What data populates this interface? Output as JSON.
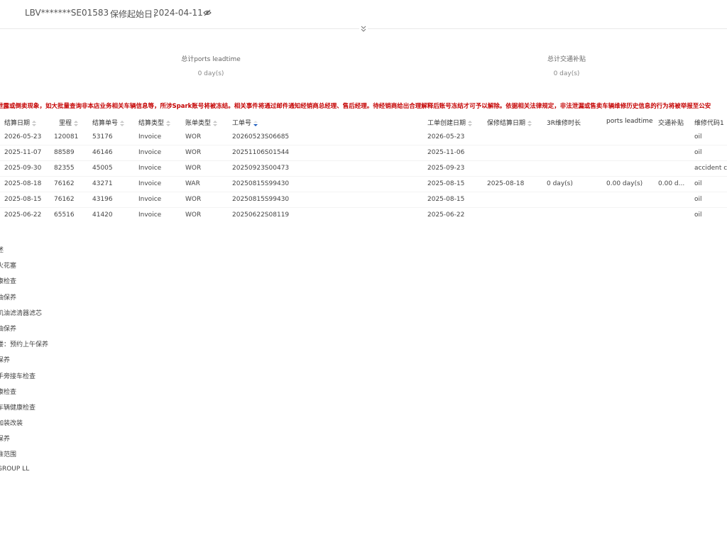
{
  "header": {
    "vin": "LBV*******SE01583",
    "warranty_start_label": "保修起始日：",
    "warranty_start_date": "2024-04-11",
    "visibility_icon": "eye-slash-icon",
    "expand_icon": "chevron-double-down-icon"
  },
  "stats": [
    {
      "label": "总计ports leadtime",
      "value": "0 day(s)"
    },
    {
      "label": "总计交通补贴",
      "value": "0 day(s)"
    }
  ],
  "warning": "泄露或倒卖现象，如大批量查询非本店业务相关车辆信息等，所涉Spark账号将被冻结。相关事件将通过邮件通知经销商总经理、售后经理。待经销商给出合理解释后账号冻结才可予以解除。依据相关法律规定，非法泄漏或售卖车辆维修历史信息的行为将被举报至公安",
  "table": {
    "columns": [
      {
        "label": "结算日期",
        "sortable": true
      },
      {
        "label": "里程",
        "sortable": true
      },
      {
        "label": "结算单号",
        "sortable": true
      },
      {
        "label": "结算类型",
        "sortable": true
      },
      {
        "label": "账单类型",
        "sortable": true
      },
      {
        "label": "工单号",
        "sortable": true,
        "active": true
      },
      {
        "label": "工单创建日期",
        "sortable": true
      },
      {
        "label": "保修结算日期",
        "sortable": true
      },
      {
        "label": "3R维修时长",
        "sortable": false
      },
      {
        "label": "ports leadtime",
        "sortable": false
      },
      {
        "label": "交通补贴",
        "sortable": false
      },
      {
        "label": "维修代码1",
        "sortable": false
      }
    ],
    "rows": [
      [
        "2026-05-23",
        "120081",
        "53176",
        "Invoice",
        "WOR",
        "20260523S06685",
        "2026-05-23",
        "",
        "",
        "",
        "",
        "oil"
      ],
      [
        "2025-11-07",
        "88589",
        "46146",
        "Invoice",
        "WOR",
        "20251106S01544",
        "2025-11-06",
        "",
        "",
        "",
        "",
        "oil"
      ],
      [
        "2025-09-30",
        "82355",
        "45005",
        "Invoice",
        "WOR",
        "20250923S00473",
        "2025-09-23",
        "",
        "",
        "",
        "",
        "accident cor"
      ],
      [
        "2025-08-18",
        "76162",
        "43271",
        "Invoice",
        "WAR",
        "20250815S99430",
        "2025-08-15",
        "2025-08-18",
        "0 day(s)",
        "0.00 day(s)",
        "0.00 d...",
        "oil"
      ],
      [
        "2025-08-15",
        "76162",
        "43196",
        "Invoice",
        "WOR",
        "20250815S99430",
        "2025-08-15",
        "",
        "",
        "",
        "",
        "oil"
      ],
      [
        "2025-06-22",
        "65516",
        "41420",
        "Invoice",
        "WOR",
        "20250622S08119",
        "2025-06-22",
        "",
        "",
        "",
        "",
        "oil"
      ]
    ]
  },
  "descriptions": [
    "述",
    "火花塞",
    "康检查",
    "油保养",
    "机油滤清器滤芯",
    "油保养",
    "楼：预约上午保养",
    "保养",
    "手旁接车检查",
    "康检查",
    "车辆健康检查",
    "加装改装",
    "保养",
    "准范围",
    "GROUP LL"
  ]
}
